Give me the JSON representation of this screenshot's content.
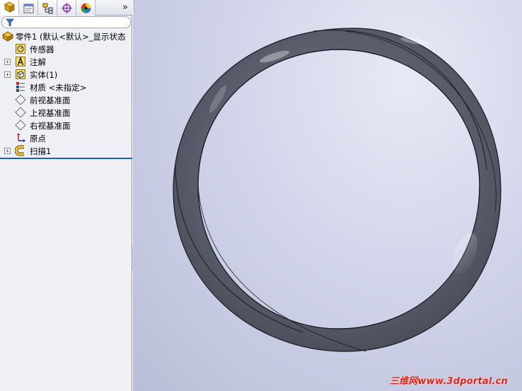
{
  "feature_manager": {
    "tabs": [
      {
        "name": "featuremanager-tab",
        "icon": "feature-tree-icon"
      },
      {
        "name": "propertymanager-tab",
        "icon": "property-icon"
      },
      {
        "name": "configurationmanager-tab",
        "icon": "configuration-icon"
      },
      {
        "name": "dimxpert-tab",
        "icon": "dimxpert-icon"
      },
      {
        "name": "display-manager-tab",
        "icon": "appearance-icon"
      }
    ],
    "more_label": "»",
    "tree": [
      {
        "id": "part",
        "label": "零件1  (默认<默认>_显示状态",
        "icon": "part-icon",
        "expander": ""
      },
      {
        "id": "sensors",
        "label": "传感器",
        "icon": "sensor-icon",
        "expander": ""
      },
      {
        "id": "annotations",
        "label": "注解",
        "icon": "annotation-icon",
        "expander": "+"
      },
      {
        "id": "solid-bodies",
        "label": "实体(1)",
        "icon": "solid-body-icon",
        "expander": "+"
      },
      {
        "id": "material",
        "label": "材质 <未指定>",
        "icon": "material-icon",
        "expander": ""
      },
      {
        "id": "front-plane",
        "label": "前视基准面",
        "icon": "plane-icon",
        "expander": ""
      },
      {
        "id": "top-plane",
        "label": "上视基准面",
        "icon": "plane-icon",
        "expander": ""
      },
      {
        "id": "right-plane",
        "label": "右视基准面",
        "icon": "plane-icon",
        "expander": ""
      },
      {
        "id": "origin",
        "label": "原点",
        "icon": "origin-icon",
        "expander": ""
      },
      {
        "id": "sweep",
        "label": "扫描1",
        "icon": "sweep-icon",
        "expander": "+"
      }
    ]
  },
  "graphics": {
    "model": "twisted-ring-sweep",
    "watermark": "三维网www.3dportal.cn"
  },
  "colors": {
    "pane_bg": "#eef0f5",
    "ring_face": "#5c5f6e",
    "ring_edge": "#1a1a22",
    "watermark": "#e2231a"
  }
}
